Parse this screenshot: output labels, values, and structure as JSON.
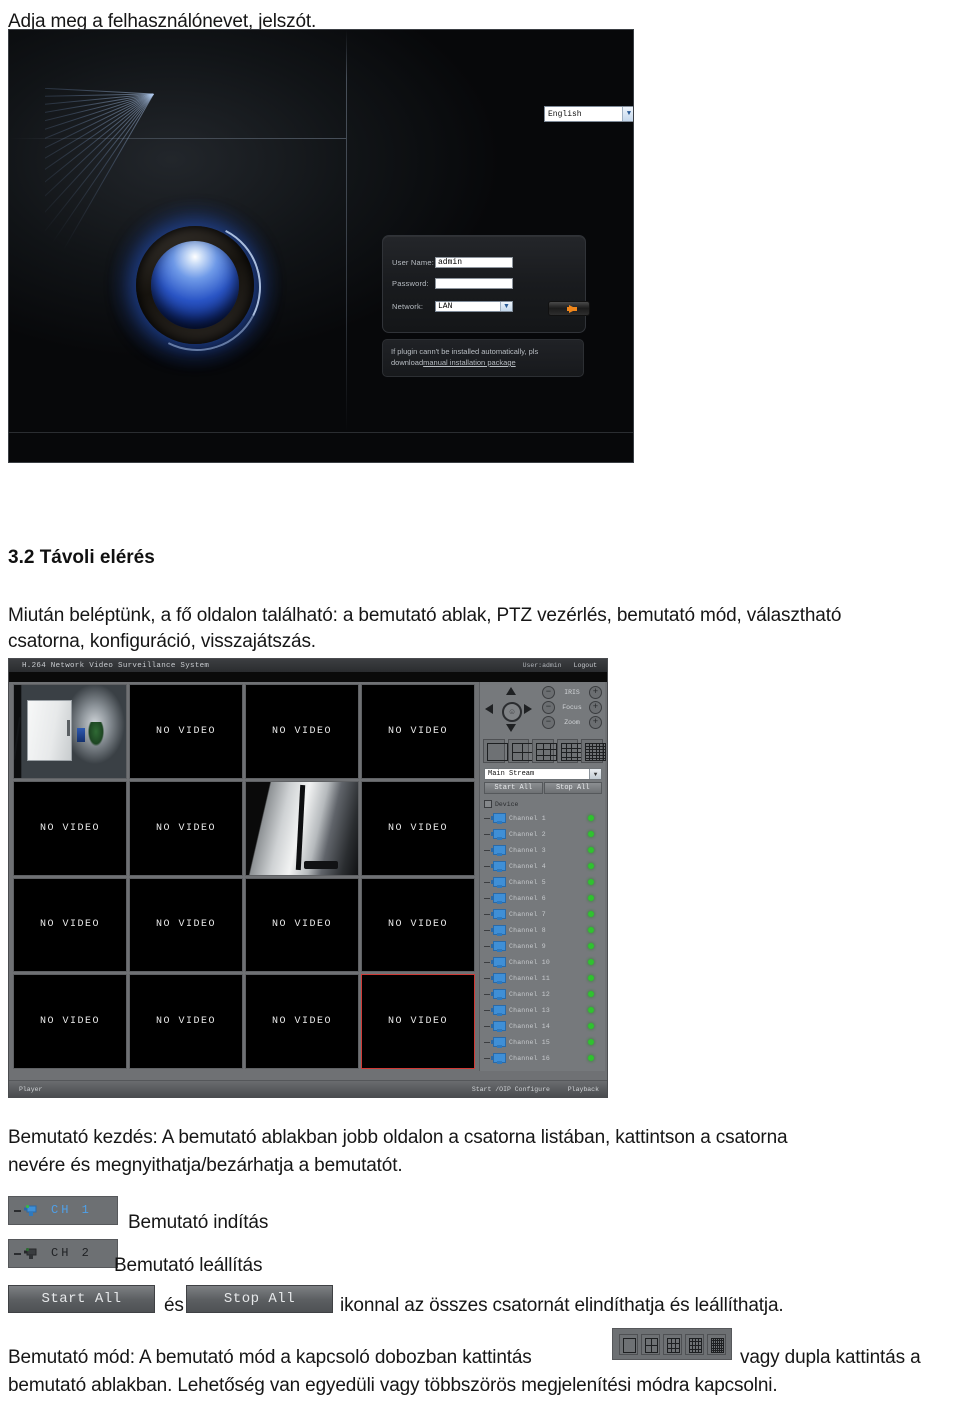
{
  "document": {
    "intro_line": "Adja meg a felhasználónevet, jelszót.",
    "section_heading": "3.2 Távoli elérés",
    "section_paragraph_line1": "Miután beléptünk, a fő oldalon található: a bemutató ablak, PTZ vezérlés, bemutató mód, választható",
    "section_paragraph_line2": "csatorna, konfiguráció, visszajátszás.",
    "demo_start_line1": "Bemutató kezdés: A bemutató ablakban jobb oldalon a csatorna listában, kattintson a csatorna",
    "demo_start_line2": "nevére és megnyithatja/bezárhatja a bemutatót.",
    "caption_start_preview": "Bemutató indítás",
    "caption_stop_preview": "Bemutató leállítás",
    "and_word": "és",
    "startstop_sentence": "ikonnal az összes csatornát elindíthatja és leállíthatja.",
    "mode_line1_pre": "Bemutató mód: A bemutató mód a kapcsoló dobozban kattintás",
    "mode_line1_post": "vagy dupla kattintás a",
    "mode_line2": "bemutató ablakban. Lehetőség van egyedüli vagy többszörös megjelenítési módra kapcsolni."
  },
  "login_screen": {
    "language": {
      "value": "English",
      "arrow": "chevron-down-icon"
    },
    "fields": [
      {
        "label": "User Name:",
        "value": "admin",
        "type": "text"
      },
      {
        "label": "Password:",
        "value": "",
        "type": "password"
      },
      {
        "label": "Network:",
        "value": "LAN",
        "type": "select"
      }
    ],
    "submit_icon": "arrow-right-icon",
    "plugin_note_line1": "If plugin cann't be installed automatically, pls",
    "plugin_note_line2_pre": "download",
    "plugin_note_link": "manual installation package"
  },
  "surveillance": {
    "title": "H.264 Network Video Surveillance System",
    "user": "User:admin",
    "logout": "Logout",
    "no_video_label": "NO VIDEO",
    "cells": [
      {
        "type": "camera",
        "variant": "room"
      },
      {
        "type": "novideo"
      },
      {
        "type": "novideo"
      },
      {
        "type": "novideo"
      },
      {
        "type": "novideo"
      },
      {
        "type": "novideo"
      },
      {
        "type": "camera",
        "variant": "grey"
      },
      {
        "type": "novideo"
      },
      {
        "type": "novideo"
      },
      {
        "type": "novideo"
      },
      {
        "type": "novideo"
      },
      {
        "type": "novideo"
      },
      {
        "type": "novideo"
      },
      {
        "type": "novideo"
      },
      {
        "type": "novideo"
      },
      {
        "type": "novideo",
        "selected": true
      }
    ],
    "ptz": {
      "up_icon": "arrow-up-icon",
      "down_icon": "arrow-down-icon",
      "left_icon": "arrow-left-icon",
      "right_icon": "arrow-right-icon",
      "center_icon": "ptz-home-icon",
      "lens_controls": [
        {
          "name": "IRIS",
          "minus": "−",
          "plus": "+"
        },
        {
          "name": "Focus",
          "minus": "−",
          "plus": "+"
        },
        {
          "name": "Zoom",
          "minus": "−",
          "plus": "+"
        }
      ]
    },
    "layout_buttons": [
      "1x1",
      "2x2",
      "3x3",
      "4x4",
      "6x6"
    ],
    "stream": {
      "selected": "Main Stream",
      "arrow": "chevron-down-icon"
    },
    "start_all": "Start All",
    "stop_all": "Stop All",
    "device_node": "Device",
    "channels": [
      {
        "name": "Channel 1",
        "status": "online"
      },
      {
        "name": "Channel 2",
        "status": "online"
      },
      {
        "name": "Channel 3",
        "status": "online"
      },
      {
        "name": "Channel 4",
        "status": "online"
      },
      {
        "name": "Channel 5",
        "status": "online"
      },
      {
        "name": "Channel 6",
        "status": "online"
      },
      {
        "name": "Channel 7",
        "status": "online"
      },
      {
        "name": "Channel 8",
        "status": "online"
      },
      {
        "name": "Channel 9",
        "status": "online"
      },
      {
        "name": "Channel 10",
        "status": "online"
      },
      {
        "name": "Channel 11",
        "status": "online"
      },
      {
        "name": "Channel 12",
        "status": "online"
      },
      {
        "name": "Channel 13",
        "status": "online"
      },
      {
        "name": "Channel 14",
        "status": "online"
      },
      {
        "name": "Channel 15",
        "status": "online"
      },
      {
        "name": "Channel 16",
        "status": "online"
      }
    ],
    "bottom_left": "Player",
    "bottom_right_1": "Start /OIP Configure",
    "bottom_right_2": "Playback"
  },
  "chips": {
    "ch1_label": "CH 1",
    "ch2_label": "CH 2",
    "start_all": "Start All",
    "stop_all": "Stop All"
  },
  "colors": {
    "accent_blue": "#2a55c6",
    "status_green": "#2fc22f",
    "selection_red": "#d03a36",
    "submit_orange": "#f0861a"
  }
}
